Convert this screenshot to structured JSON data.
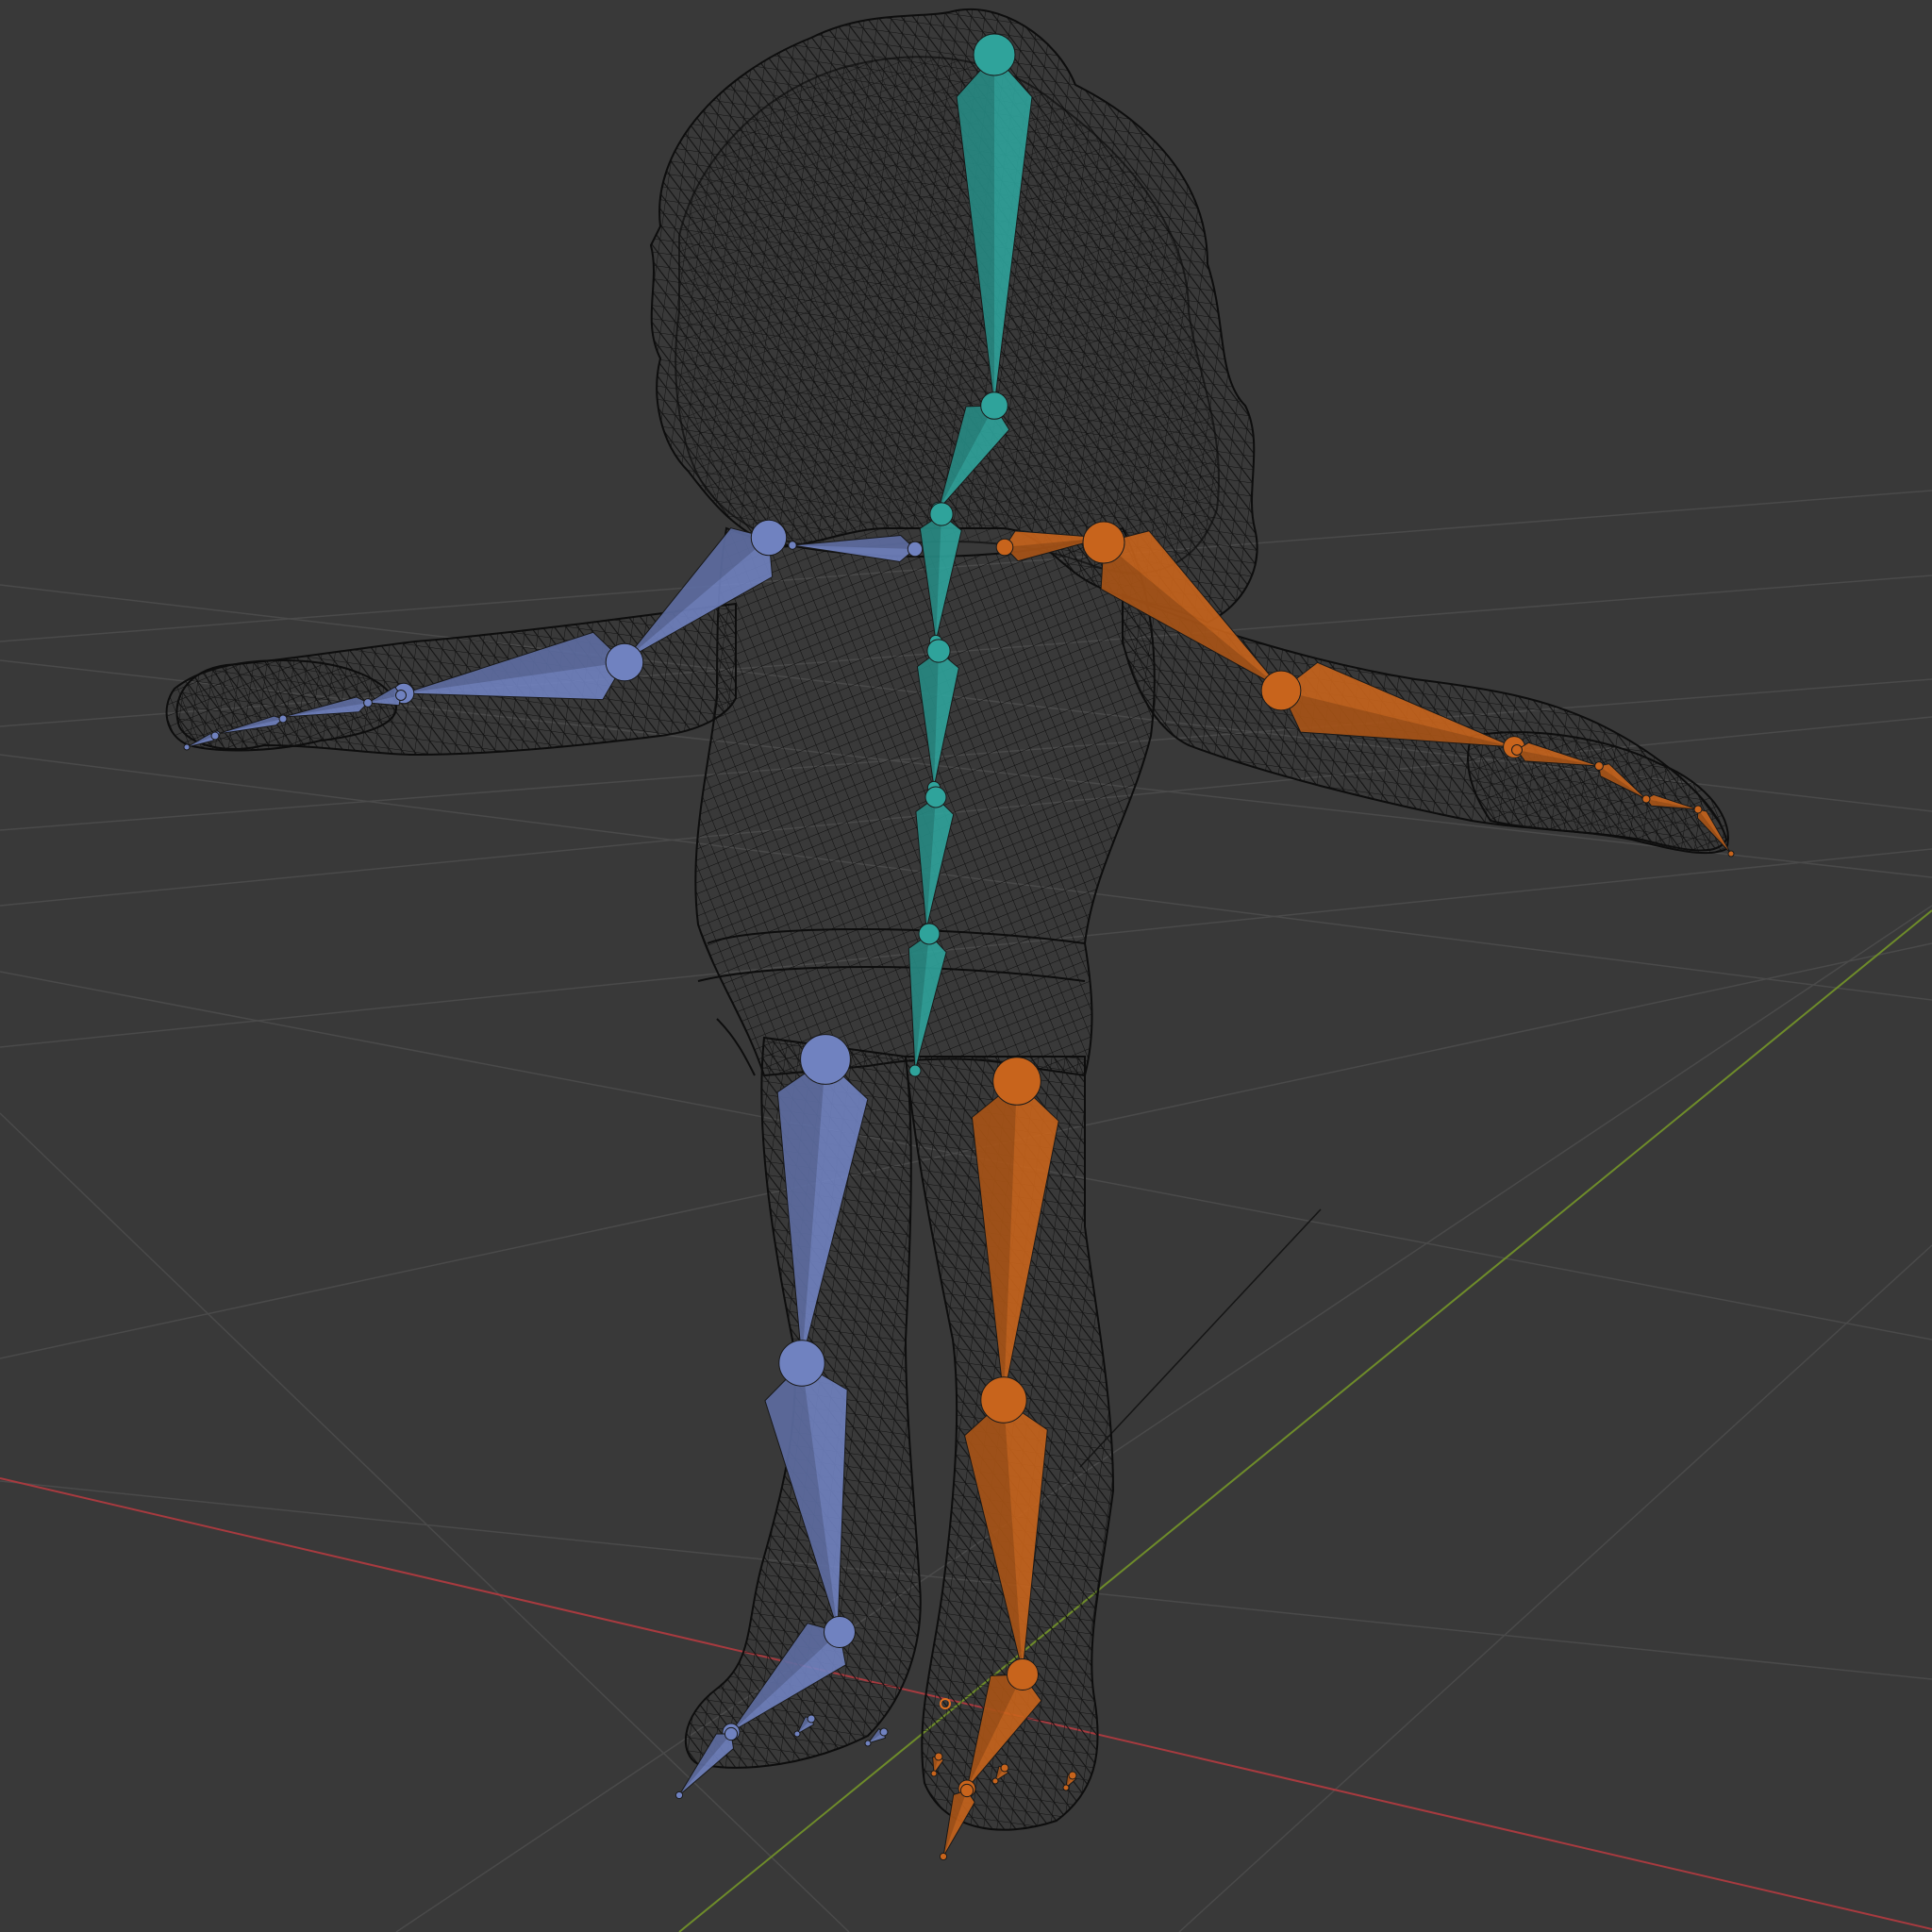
{
  "viewport": {
    "background": "#393939",
    "grid_color": "#4a4a4a",
    "x_axis_color": "#a83a3f",
    "y_axis_color": "#6e8c2a",
    "wire_color": "#0d0d0d"
  },
  "armature": {
    "colors": {
      "center": "#2fa39b",
      "left": "#7082c0",
      "right": "#c8641c"
    },
    "bone_groups": [
      {
        "name": "spine-chain",
        "color_key": "center"
      },
      {
        "name": "left-arm",
        "color_key": "left"
      },
      {
        "name": "right-arm",
        "color_key": "right"
      },
      {
        "name": "left-leg",
        "color_key": "left"
      },
      {
        "name": "right-leg",
        "color_key": "right"
      }
    ]
  },
  "mesh": {
    "display": "wireframe",
    "icon": "character-mesh-icon"
  }
}
